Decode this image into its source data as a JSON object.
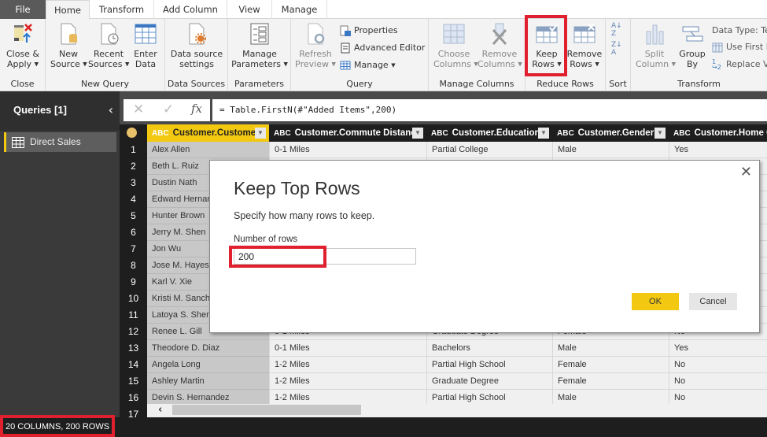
{
  "tabs": [
    {
      "label": "File"
    },
    {
      "label": "Home",
      "active": true
    },
    {
      "label": "Transform"
    },
    {
      "label": "Add Column"
    },
    {
      "label": "View"
    },
    {
      "label": "Manage"
    }
  ],
  "ribbon": {
    "close": {
      "group": "Close",
      "close_apply": [
        "Close &",
        "Apply"
      ]
    },
    "new_query": {
      "group": "New Query",
      "new_source": [
        "New",
        "Source"
      ],
      "recent_sources": [
        "Recent",
        "Sources"
      ],
      "enter_data": [
        "Enter",
        "Data"
      ]
    },
    "data_sources": {
      "group": "Data Sources",
      "settings": [
        "Data source",
        "settings"
      ]
    },
    "parameters": {
      "group": "Parameters",
      "manage": [
        "Manage",
        "Parameters"
      ]
    },
    "query": {
      "group": "Query",
      "refresh": [
        "Refresh",
        "Preview"
      ],
      "properties": "Properties",
      "advanced_editor": "Advanced Editor",
      "manage": "Manage"
    },
    "manage_columns": {
      "group": "Manage Columns",
      "choose": [
        "Choose",
        "Columns"
      ],
      "remove": [
        "Remove",
        "Columns"
      ]
    },
    "reduce_rows": {
      "group": "Reduce Rows",
      "keep": [
        "Keep",
        "Rows"
      ],
      "remove": [
        "Remove",
        "Rows"
      ]
    },
    "sort": {
      "group": "Sort"
    },
    "transform": {
      "group": "Transform",
      "split": [
        "Split",
        "Column"
      ],
      "group_by": [
        "Group",
        "By"
      ],
      "data_type": "Data Type: Text",
      "use_first": "Use First Row as Headers",
      "replace": "Replace Values"
    }
  },
  "queries": {
    "title": "Queries [1]",
    "items": [
      {
        "label": "Direct Sales"
      }
    ]
  },
  "formula_bar": {
    "fx": "fx",
    "formula": "= Table.FirstN(#\"Added Items\",200)"
  },
  "table": {
    "type_label": "ABC",
    "columns": [
      "Customer.Customer",
      "Customer.Commute Distance",
      "Customer.Education",
      "Customer.Gender",
      "Customer.Home Ow"
    ],
    "rows": [
      {
        "n": "1",
        "cells": [
          "Alex Allen",
          "0-1 Miles",
          "Partial College",
          "Male",
          "Yes"
        ]
      },
      {
        "n": "2",
        "cells": [
          "Beth L. Ruiz",
          "",
          "",
          "",
          ""
        ]
      },
      {
        "n": "3",
        "cells": [
          "Dustin Nath",
          "",
          "",
          "",
          ""
        ]
      },
      {
        "n": "4",
        "cells": [
          "Edward Hernandez",
          "",
          "",
          "",
          ""
        ]
      },
      {
        "n": "5",
        "cells": [
          "Hunter Brown",
          "",
          "",
          "",
          ""
        ]
      },
      {
        "n": "6",
        "cells": [
          "Jerry M. Shen",
          "",
          "",
          "",
          ""
        ]
      },
      {
        "n": "7",
        "cells": [
          "Jon Wu",
          "",
          "",
          "",
          ""
        ]
      },
      {
        "n": "8",
        "cells": [
          "Jose M. Hayes",
          "",
          "",
          "",
          ""
        ]
      },
      {
        "n": "9",
        "cells": [
          "Karl V. Xie",
          "",
          "",
          "",
          ""
        ]
      },
      {
        "n": "10",
        "cells": [
          "Kristi M. Sanchez",
          "",
          "",
          "",
          ""
        ]
      },
      {
        "n": "11",
        "cells": [
          "Latoya S. Shen",
          "",
          "",
          "",
          ""
        ]
      },
      {
        "n": "12",
        "cells": [
          "Renee L. Gill",
          "0-1 Miles",
          "Graduate Degree",
          "Female",
          "No"
        ]
      },
      {
        "n": "13",
        "cells": [
          "Theodore D. Diaz",
          "0-1 Miles",
          "Bachelors",
          "Male",
          "Yes"
        ]
      },
      {
        "n": "14",
        "cells": [
          "Angela Long",
          "1-2 Miles",
          "Partial High School",
          "Female",
          "No"
        ]
      },
      {
        "n": "15",
        "cells": [
          "Ashley Martin",
          "1-2 Miles",
          "Graduate Degree",
          "Female",
          "No"
        ]
      },
      {
        "n": "16",
        "cells": [
          "Devin S. Hernandez",
          "1-2 Miles",
          "Partial High School",
          "Male",
          "No"
        ]
      },
      {
        "n": "17",
        "cells": [
          "",
          "",
          "",
          "",
          ""
        ]
      }
    ]
  },
  "status": {
    "text": "20 COLUMNS, 200 ROWS"
  },
  "dialog": {
    "title": "Keep Top Rows",
    "description": "Specify how many rows to keep.",
    "field_label": "Number of rows",
    "field_value": "200",
    "ok": "OK",
    "cancel": "Cancel"
  },
  "colors": {
    "accent": "#f2c811",
    "highlight": "#e0202e",
    "dark": "#1e1e1e"
  }
}
